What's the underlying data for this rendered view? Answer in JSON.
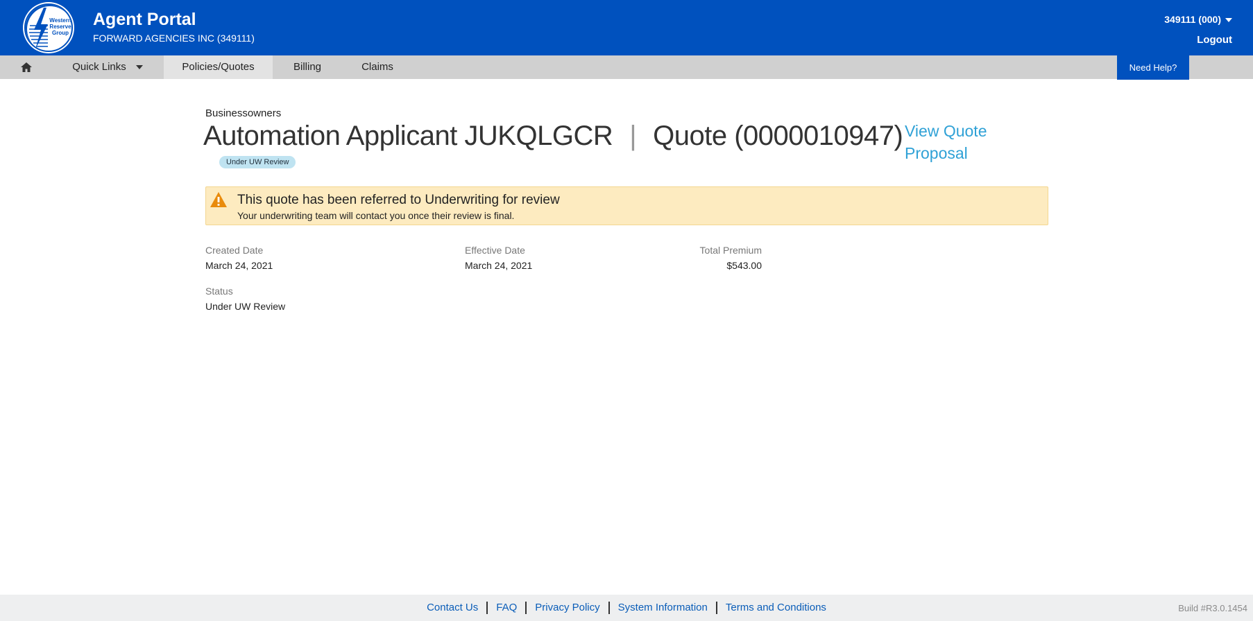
{
  "header": {
    "logo_text": "Western Reserve Group",
    "app_title": "Agent Portal",
    "agency": "FORWARD AGENCIES INC (349111)",
    "account": "349111 (000)",
    "logout": "Logout"
  },
  "nav": {
    "home_icon": "home-icon",
    "quick_links": "Quick Links",
    "policies_quotes": "Policies/Quotes",
    "billing": "Billing",
    "claims": "Claims",
    "need_help": "Need Help?"
  },
  "quote": {
    "line_of_business": "Businessowners",
    "applicant": "Automation Applicant JUKQLGCR",
    "separator": "|",
    "quote_label": "Quote (0000010947)",
    "status_pill": "Under UW Review",
    "view_proposal": "View Quote Proposal"
  },
  "alert": {
    "icon": "warning-icon",
    "title": "This quote has been referred to Underwriting for review",
    "message": "Your underwriting team will contact you once their review is final."
  },
  "details": {
    "created_label": "Created Date",
    "created_value": "March 24, 2021",
    "effective_label": "Effective Date",
    "effective_value": "March 24, 2021",
    "premium_label": "Total Premium",
    "premium_value": "$543.00",
    "status_label": "Status",
    "status_value": "Under UW Review"
  },
  "footer": {
    "links": [
      "Contact Us",
      "FAQ",
      "Privacy Policy",
      "System Information",
      "Terms and Conditions"
    ],
    "build": "Build #R3.0.1454"
  },
  "colors": {
    "brand_blue": "#0051BE",
    "link_blue": "#2FA1D6",
    "alert_bg": "#FDEBC0",
    "warning_orange": "#E98B0C"
  }
}
